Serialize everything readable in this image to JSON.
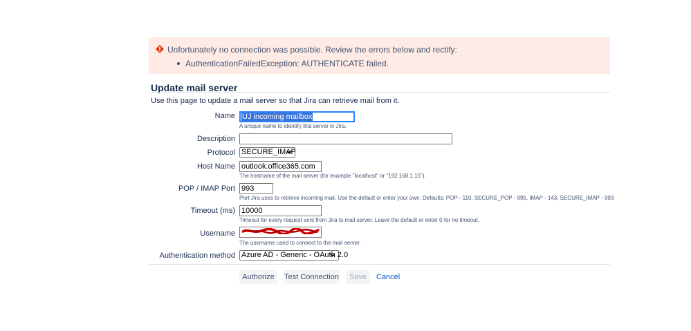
{
  "error": {
    "icon": "error-icon",
    "message": "Unfortunately no connection was possible. Review the errors below and rectify:",
    "items": [
      "AuthenticationFailedException: AUTHENTICATE failed."
    ],
    "color": "#de350b",
    "background": "#ffebe6"
  },
  "form": {
    "title": "Update mail server",
    "intro": "Use this page to update a mail server so that Jira can retrieve mail from it.",
    "fields": {
      "name": {
        "label": "Name",
        "value": "UJ incoming mailbox",
        "help": "A unique name to identify this server in Jira."
      },
      "description": {
        "label": "Description",
        "value": ""
      },
      "protocol": {
        "label": "Protocol",
        "value": "SECURE_IMAP"
      },
      "host": {
        "label": "Host Name",
        "value": "outlook.office365.com",
        "help": "The hostname of the mail server (for example \"localhost\" or \"192.168.1.15\")."
      },
      "port": {
        "label": "POP / IMAP Port",
        "value": "993",
        "help": "Port Jira uses to retrieve incoming mail. Use the default or enter your own. Defaults: POP - 110, SECURE_POP - 995, IMAP - 143, SECURE_IMAP - 993"
      },
      "timeout": {
        "label": "Timeout (ms)",
        "value": "10000",
        "help": "Timeout for every request sent from Jira to mail server. Leave the default or enter 0 for no timeout."
      },
      "username": {
        "label": "Username",
        "value": "",
        "help": "The username used to connect to the mail server."
      },
      "auth_method": {
        "label": "Authentication method",
        "value": "Azure AD - Generic - OAuth 2.0"
      }
    }
  },
  "buttons": {
    "authorize": "Authorize",
    "test_connection": "Test Connection",
    "save": "Save",
    "cancel": "Cancel"
  }
}
